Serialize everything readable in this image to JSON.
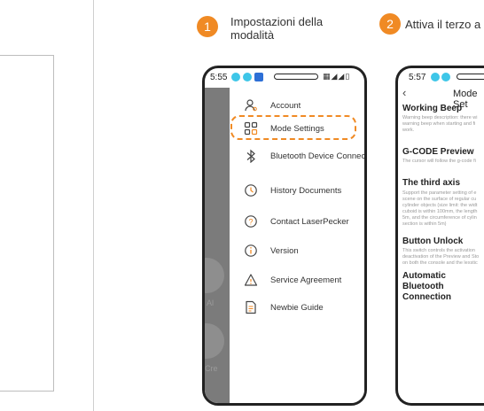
{
  "steps": [
    {
      "number": "1",
      "text_line1": "Impostazioni della",
      "text_line2": "modalità"
    },
    {
      "number": "2",
      "text": "Attiva il terzo a"
    }
  ],
  "phone1": {
    "status_time": "5:55",
    "menu": [
      {
        "label": "Account",
        "icon": "user-icon"
      },
      {
        "label": "Mode Settings",
        "icon": "grid-icon",
        "highlighted": true
      },
      {
        "label": "Bluetooth Device Connection",
        "icon": "bluetooth-icon"
      },
      {
        "label": "History Documents",
        "icon": "clock-icon"
      },
      {
        "label": "Contact LaserPecker",
        "icon": "question-icon"
      },
      {
        "label": "Version",
        "icon": "info-icon"
      },
      {
        "label": "Service Agreement",
        "icon": "warning-icon"
      },
      {
        "label": "Newbie Guide",
        "icon": "document-icon"
      }
    ],
    "background_labels": [
      "Al",
      "Cre"
    ]
  },
  "phone2": {
    "status_time": "5:57",
    "title": "Mode Set",
    "sections": [
      {
        "heading": "Working Beep",
        "desc": [
          "Warning beep description: there wi",
          "warning beep when starting and fi",
          "work."
        ]
      },
      {
        "heading": "G-CODE Preview",
        "desc": [
          "The cursor will follow the g-code fi"
        ]
      },
      {
        "heading": "The third axis",
        "desc": [
          "Support the parameter setting of e",
          "scene on the surface of regular cu",
          "cylinder objects (size limit: the widt",
          "cuboid is within 100mm, the length",
          "5m, and the circumference of cylin",
          "section is within 5m)"
        ]
      },
      {
        "heading": "Button Unlock",
        "desc": [
          "This switch controls the activation",
          "deactivation of the Preview and Sto",
          "on both the console and the lexstic"
        ]
      },
      {
        "heading": "Automatic Bluetooth\nConnection",
        "desc": []
      }
    ]
  },
  "colors": {
    "accent": "#f08a24",
    "status_teal": "#3ec6e8",
    "status_blue": "#2d6fd6",
    "dim": "#7b7b7b"
  }
}
